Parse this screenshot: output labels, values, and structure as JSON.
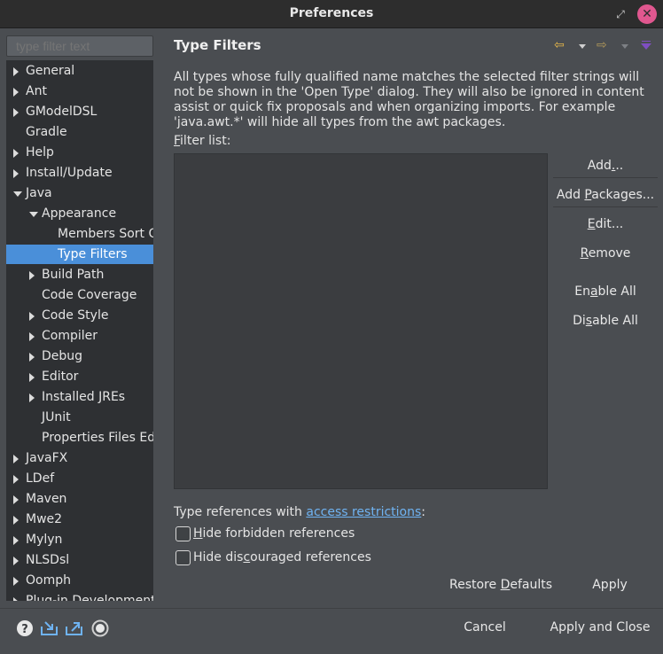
{
  "window": {
    "title": "Preferences",
    "restore_glyph": "⤢",
    "close_glyph": "✕"
  },
  "sidebar": {
    "filter_placeholder": "type filter text",
    "items": [
      {
        "label": "General",
        "depth": 0,
        "expander": "collapsed"
      },
      {
        "label": "Ant",
        "depth": 0,
        "expander": "collapsed"
      },
      {
        "label": "GModelDSL",
        "depth": 0,
        "expander": "collapsed"
      },
      {
        "label": "Gradle",
        "depth": 0,
        "expander": "none"
      },
      {
        "label": "Help",
        "depth": 0,
        "expander": "collapsed"
      },
      {
        "label": "Install/Update",
        "depth": 0,
        "expander": "collapsed"
      },
      {
        "label": "Java",
        "depth": 0,
        "expander": "expanded"
      },
      {
        "label": "Appearance",
        "depth": 1,
        "expander": "expanded"
      },
      {
        "label": "Members Sort Order",
        "depth": 2,
        "expander": "none"
      },
      {
        "label": "Type Filters",
        "depth": 2,
        "expander": "none",
        "selected": true
      },
      {
        "label": "Build Path",
        "depth": 1,
        "expander": "collapsed"
      },
      {
        "label": "Code Coverage",
        "depth": 1,
        "expander": "none"
      },
      {
        "label": "Code Style",
        "depth": 1,
        "expander": "collapsed"
      },
      {
        "label": "Compiler",
        "depth": 1,
        "expander": "collapsed"
      },
      {
        "label": "Debug",
        "depth": 1,
        "expander": "collapsed"
      },
      {
        "label": "Editor",
        "depth": 1,
        "expander": "collapsed"
      },
      {
        "label": "Installed JREs",
        "depth": 1,
        "expander": "collapsed"
      },
      {
        "label": "JUnit",
        "depth": 1,
        "expander": "none"
      },
      {
        "label": "Properties Files Editor",
        "depth": 1,
        "expander": "none"
      },
      {
        "label": "JavaFX",
        "depth": 0,
        "expander": "collapsed"
      },
      {
        "label": "LDef",
        "depth": 0,
        "expander": "collapsed"
      },
      {
        "label": "Maven",
        "depth": 0,
        "expander": "collapsed"
      },
      {
        "label": "Mwe2",
        "depth": 0,
        "expander": "collapsed"
      },
      {
        "label": "Mylyn",
        "depth": 0,
        "expander": "collapsed"
      },
      {
        "label": "NLSDsl",
        "depth": 0,
        "expander": "collapsed"
      },
      {
        "label": "Oomph",
        "depth": 0,
        "expander": "collapsed"
      },
      {
        "label": "Plug-in Development",
        "depth": 0,
        "expander": "collapsed"
      }
    ]
  },
  "page": {
    "title": "Type Filters",
    "description": "All types whose fully qualified name matches the selected filter strings will not be shown in the 'Open Type' dialog. They will also be ignored in content assist or quick fix proposals and when organizing imports. For example 'java.awt.*' will hide all types from the awt packages.",
    "filter_list_label_mnemonic": "F",
    "filter_list_label_rest": "ilter list:",
    "buttons": {
      "add": {
        "pre": "Add",
        "mn": ".",
        "post": ".."
      },
      "add_packages": {
        "pre": "Add ",
        "mn": "P",
        "post": "ackages..."
      },
      "edit": {
        "pre": "",
        "mn": "E",
        "post": "dit..."
      },
      "remove": {
        "pre": "",
        "mn": "R",
        "post": "emove"
      },
      "enable_all": {
        "pre": "En",
        "mn": "a",
        "post": "ble All"
      },
      "disable_all": {
        "pre": "Di",
        "mn": "s",
        "post": "able All"
      }
    },
    "references_text": "Type references with ",
    "references_link": "access restrictions",
    "references_suffix": ":",
    "hide_forbidden": {
      "pre": "",
      "mn": "H",
      "post": "ide forbidden references",
      "checked": false
    },
    "hide_discouraged": {
      "pre": "Hide dis",
      "mn": "c",
      "post": "ouraged references",
      "checked": false
    },
    "restore_defaults": {
      "pre": "Restore ",
      "mn": "D",
      "post": "efaults"
    },
    "apply": "Apply"
  },
  "footer": {
    "cancel": "Cancel",
    "apply_close": "Apply and Close"
  },
  "colors": {
    "accent": "#4a8fd9",
    "link": "#6fb3f2",
    "close_button": "#e0578f",
    "nav_back": "#e8b84a",
    "view_menu": "#7f4ec2"
  }
}
